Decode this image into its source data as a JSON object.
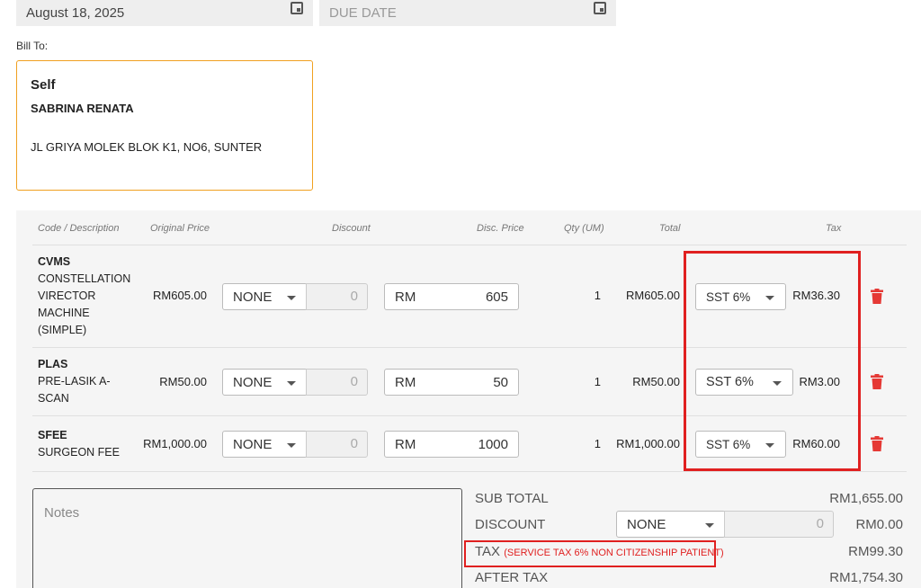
{
  "header": {
    "invoice_date": "August 18, 2025",
    "due_date_placeholder": "DUE DATE"
  },
  "bill_to": {
    "label": "Bill To:",
    "type": "Self",
    "name": "SABRINA RENATA",
    "address": "JL GRIYA MOLEK BLOK K1, NO6, SUNTER"
  },
  "table": {
    "headers": {
      "code_desc": "Code / Description",
      "original_price": "Original Price",
      "discount": "Discount",
      "disc_price": "Disc. Price",
      "qty": "Qty (UM)",
      "total": "Total",
      "tax": "Tax"
    },
    "rows": [
      {
        "code": "CVMS",
        "description": "CONSTELLATION VIRECTOR MACHINE (SIMPLE)",
        "original_price": "RM605.00",
        "discount_type": "NONE",
        "discount_value": "0",
        "currency": "RM",
        "disc_price": "605",
        "qty": "1",
        "total": "RM605.00",
        "tax_option": "SST 6%",
        "tax_amount": "RM36.30"
      },
      {
        "code": "PLAS",
        "description": "PRE-LASIK A-SCAN",
        "original_price": "RM50.00",
        "discount_type": "NONE",
        "discount_value": "0",
        "currency": "RM",
        "disc_price": "50",
        "qty": "1",
        "total": "RM50.00",
        "tax_option": "SST 6%",
        "tax_amount": "RM3.00"
      },
      {
        "code": "SFEE",
        "description": "SURGEON FEE",
        "original_price": "RM1,000.00",
        "discount_type": "NONE",
        "discount_value": "0",
        "currency": "RM",
        "disc_price": "1000",
        "qty": "1",
        "total": "RM1,000.00",
        "tax_option": "SST 6%",
        "tax_amount": "RM60.00"
      }
    ]
  },
  "notes": {
    "placeholder": "Notes"
  },
  "summary": {
    "subtotal_label": "SUB TOTAL",
    "subtotal": "RM1,655.00",
    "discount_label": "DISCOUNT",
    "discount_type": "NONE",
    "discount_value": "0",
    "discount": "RM0.00",
    "tax_label": "TAX",
    "tax_note": "(SERVICE TAX 6% NON CITIZENSHIP PATIENT)",
    "tax": "RM99.30",
    "after_tax_label": "AFTER TAX",
    "after_tax": "RM1,754.30"
  },
  "colors": {
    "accent_orange": "#f0a020",
    "highlight_red": "#e02020",
    "trash_red": "#e53935"
  },
  "icons": [
    "calendar-icon",
    "caret-down-icon",
    "trash-icon"
  ]
}
